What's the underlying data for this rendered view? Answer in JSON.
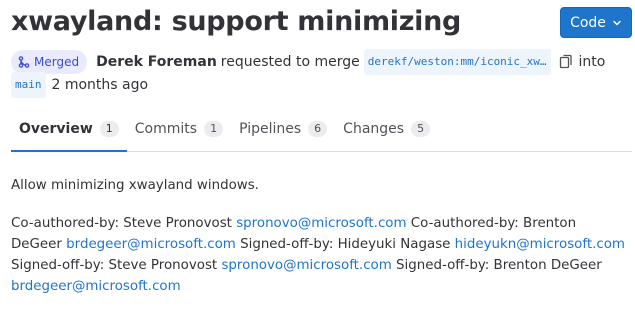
{
  "title": "xwayland: support minimizing",
  "code_button": {
    "label": "Code",
    "icon": "chevron-down-icon"
  },
  "meta": {
    "status_badge": "Merged",
    "author": "Derek Foreman",
    "action_text": "requested to merge",
    "source_branch": "derekf/weston:mm/iconic_xw…",
    "into_text": "into",
    "target_branch": "main",
    "time_ago": "2 months ago"
  },
  "tabs": [
    {
      "label": "Overview",
      "count": "1",
      "active": true
    },
    {
      "label": "Commits",
      "count": "1",
      "active": false
    },
    {
      "label": "Pipelines",
      "count": "6",
      "active": false
    },
    {
      "label": "Changes",
      "count": "5",
      "active": false
    }
  ],
  "description": {
    "summary": "Allow minimizing xwayland windows.",
    "trailers": [
      {
        "text": "Co-authored-by: Steve Pronovost ",
        "email": "spronovo@microsoft.com"
      },
      {
        "text": " Co-authored-by: Brenton DeGeer ",
        "email": "brdegeer@microsoft.com"
      },
      {
        "text": " Signed-off-by: Hideyuki Nagase ",
        "email": "hideyukn@microsoft.com"
      },
      {
        "text": " Signed-off-by: Steve Pronovost ",
        "email": "spronovo@microsoft.com"
      },
      {
        "text": " Signed-off-by: Brenton DeGeer ",
        "email": "brdegeer@microsoft.com"
      }
    ]
  },
  "colors": {
    "accent": "#1f75cb",
    "merged_badge_bg": "#e9ebfc",
    "merged_badge_fg": "#3b4ad6"
  }
}
